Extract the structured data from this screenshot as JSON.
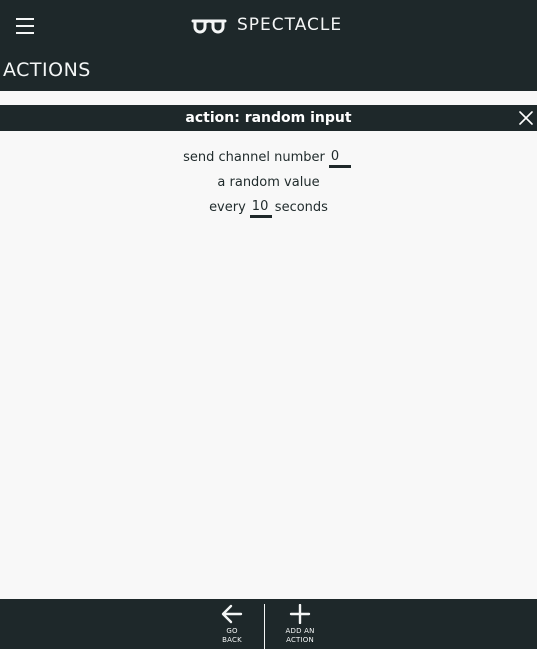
{
  "header": {
    "brand_name": "SPECTACLE",
    "section_title": "ACTIONS"
  },
  "action_panel": {
    "title": "action: random input",
    "line1_prefix": "send channel number",
    "channel_value": "0",
    "line2": "a random value",
    "line3_prefix": "every",
    "seconds_value": "10",
    "line3_suffix": "seconds"
  },
  "footer": {
    "go_back_line1": "GO",
    "go_back_line2": "BACK",
    "add_action_line1": "ADD AN",
    "add_action_line2": "ACTION"
  },
  "icons": {
    "menu": "hamburger-menu-icon",
    "logo": "spectacles-logo-icon",
    "close": "close-icon",
    "back": "arrow-left-icon",
    "add": "plus-icon"
  },
  "colors": {
    "bar_background": "#1e282a",
    "page_background": "#f8f8f8",
    "bar_text": "#f4f6f6"
  }
}
